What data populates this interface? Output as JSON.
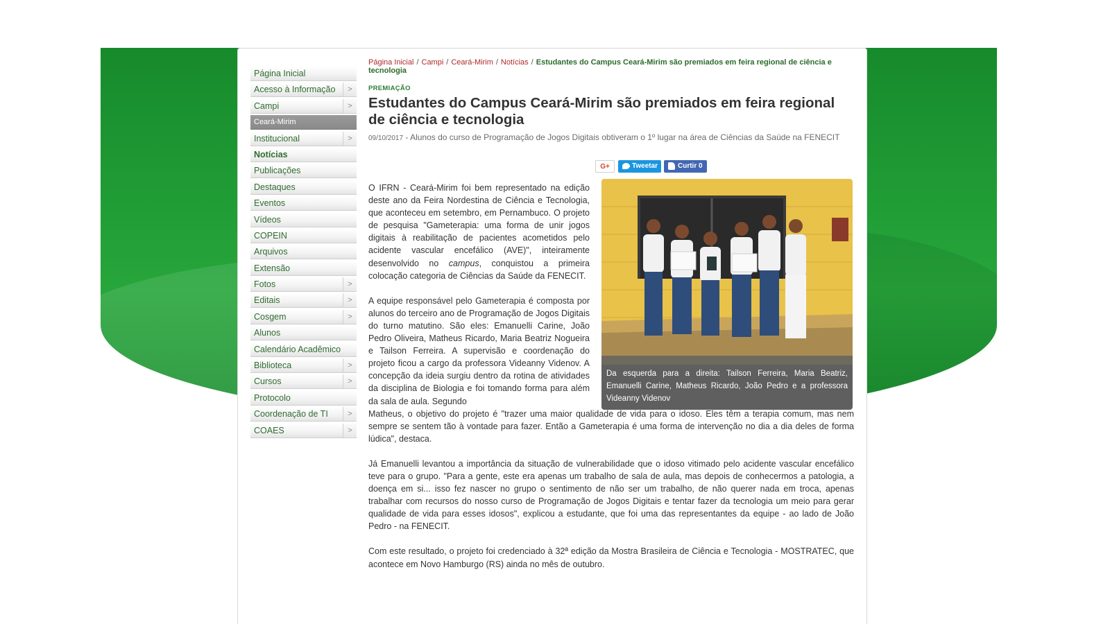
{
  "sidebar": {
    "items": [
      {
        "label": "Página Inicial",
        "arrow": false
      },
      {
        "label": "Acesso à Informação",
        "arrow": true
      },
      {
        "label": "Campi",
        "arrow": true
      },
      {
        "label": "Ceará-Mirim",
        "arrow": false,
        "active": true
      },
      {
        "label": "Institucional",
        "arrow": true
      },
      {
        "label": "Notícias",
        "arrow": false,
        "bold": true
      },
      {
        "label": "Publicações",
        "arrow": false
      },
      {
        "label": "Destaques",
        "arrow": false
      },
      {
        "label": "Eventos",
        "arrow": false
      },
      {
        "label": "Vídeos",
        "arrow": false
      },
      {
        "label": "COPEIN",
        "arrow": false
      },
      {
        "label": "Arquivos",
        "arrow": false
      },
      {
        "label": "Extensão",
        "arrow": false
      },
      {
        "label": "Fotos",
        "arrow": true
      },
      {
        "label": "Editais",
        "arrow": true
      },
      {
        "label": "Cosgem",
        "arrow": true
      },
      {
        "label": "Alunos",
        "arrow": false
      },
      {
        "label": "Calendário Acadêmico",
        "arrow": false
      },
      {
        "label": "Biblioteca",
        "arrow": true
      },
      {
        "label": "Cursos",
        "arrow": true
      },
      {
        "label": "Protocolo",
        "arrow": false
      },
      {
        "label": "Coordenação de TI",
        "arrow": true
      },
      {
        "label": "COAES",
        "arrow": true
      }
    ],
    "arrow_glyph": ">"
  },
  "breadcrumb": {
    "items": [
      "Página Inicial",
      "Campi",
      "Ceará-Mirim",
      "Notícias"
    ],
    "separator": "/",
    "current": "Estudantes do Campus Ceará-Mirim são premiados em feira regional de ciência e tecnologia"
  },
  "article": {
    "kicker": "PREMIAÇÃO",
    "title": "Estudantes do Campus Ceará-Mirim são premiados em feira regional de ciência e tecnologia",
    "date": "09/10/2017",
    "summary": " - Alunos do curso de Programação de Jogos Digitais obtiveram o 1º lugar na área de Ciências da Saúde na FENECIT",
    "share": {
      "gplus": "G+",
      "tweet": "Tweetar",
      "like": "Curtir 0"
    },
    "photo_caption": "Da esquerda para a direita: Tailson Ferreira, Maria Beatriz, Emanuelli Carine, Matheus Ricardo, João Pedro e a professora Videanny Videnov",
    "p1_before": "O IFRN - Ceará-Mirim foi bem representado na edição deste ano da Feira Nordestina de Ciência e Tecnologia, que aconteceu em setembro, em Pernambuco. O projeto de pesquisa \"Gameterapia: uma forma de unir jogos digitais à reabilitação de pacientes acometidos pelo acidente vascular encefálico (AVE)\", inteiramente desenvolvido no ",
    "p1_em": "campus",
    "p1_after": ", conquistou a primeira colocação categoria de Ciências da Saúde da FENECIT.",
    "p2": "A equipe responsável pelo Gameterapia é composta por alunos do terceiro ano de Programação de Jogos Digitais do turno matutino. São eles: Emanuelli Carine, João Pedro Oliveira, Matheus Ricardo, Maria Beatriz Nogueira e Tailson Ferreira. A supervisão e coordenação do projeto ficou a cargo da professora Videanny Videnov. A concepção da ideia surgiu dentro da rotina de atividades da disciplina de Biologia e foi tomando forma para além da sala de aula. Segundo",
    "p2_cont": "Matheus, o objetivo do projeto é \"trazer uma maior qualidade de vida para o idoso. Eles têm a terapia comum, mas nem sempre se sentem tão à vontade para fazer. Então a Gameterapia é uma forma de intervenção no dia a dia deles de forma lúdica\", destaca.",
    "p3": "Já Emanuelli levantou a importância da situação de vulnerabilidade que o idoso vitimado pelo acidente vascular encefálico teve para o grupo. \"Para a gente, este era apenas um trabalho de sala de aula, mas depois de conhecermos a patologia, a doença em si... isso fez nascer no grupo o sentimento de não ser um trabalho, de não querer nada em troca, apenas trabalhar com recursos do nosso curso de Programação de Jogos Digitais e tentar fazer da tecnologia um meio para gerar qualidade de vida para esses idosos\", explicou a estudante, que foi uma das representantes da equipe - ao lado de João Pedro - na FENECIT.",
    "p4": "Com este resultado, o projeto foi credenciado à 32ª edição da Mostra Brasileira de Ciência e Tecnologia - MOSTRATEC, que acontece em Novo Hamburgo (RS) ainda no mês de outubro."
  },
  "colors": {
    "brand_green": "#1f9a34",
    "link_red": "#b02828",
    "nav_green": "#2f6b2f",
    "caption_bg": "#5f5f5f",
    "twitter": "#1b95e0",
    "facebook": "#4267b2"
  }
}
